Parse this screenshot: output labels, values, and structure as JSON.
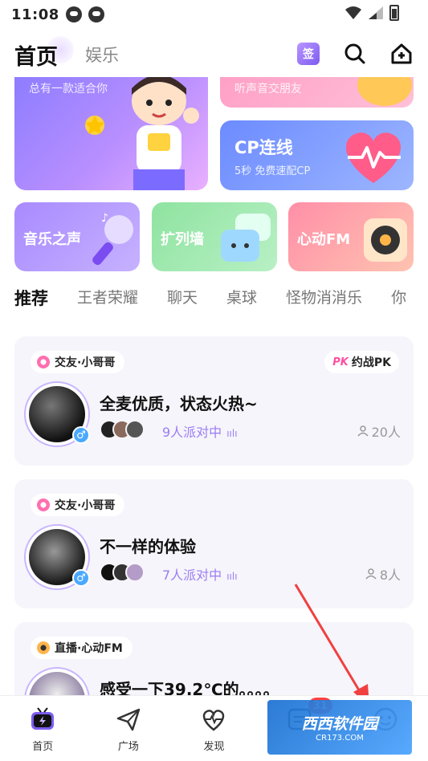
{
  "status": {
    "time": "11:08"
  },
  "header": {
    "tab_home": "首页",
    "tab_ent": "娱乐",
    "sign_label": "签"
  },
  "banners": {
    "left_sub": "总有一款适合你",
    "right_top_sub": "听声音交朋友",
    "cp_title": "CP连线",
    "cp_sub": "5秒 免费速配CP"
  },
  "tiles": [
    {
      "label": "音乐之声"
    },
    {
      "label": "扩列墙"
    },
    {
      "label": "心动FM"
    }
  ],
  "category_tabs": [
    "推荐",
    "王者荣耀",
    "聊天",
    "桌球",
    "怪物消消乐",
    "你"
  ],
  "rooms": [
    {
      "tag": "交友·小哥哥",
      "pk": "约战PK",
      "pk_badge": "PK",
      "title": "全麦优质，状态火热~",
      "party": "9人派对中",
      "count": "20人"
    },
    {
      "tag": "交友·小哥哥",
      "title": "不一样的体验",
      "party": "7人派对中",
      "count": "8人"
    },
    {
      "tag": "直播·心动FM",
      "title": "感受一下39.2℃的。。。。"
    }
  ],
  "bottom_nav": [
    {
      "label": "首页"
    },
    {
      "label": "广场"
    },
    {
      "label": "发现"
    },
    {
      "label": "",
      "badge": "31"
    },
    {
      "label": ""
    }
  ],
  "watermark": {
    "main": "西西软件园",
    "sub": "CR173.COM"
  },
  "colors": {
    "accent": "#7d5cf0",
    "party": "#9b7cf4",
    "badge": "#ff4040"
  }
}
